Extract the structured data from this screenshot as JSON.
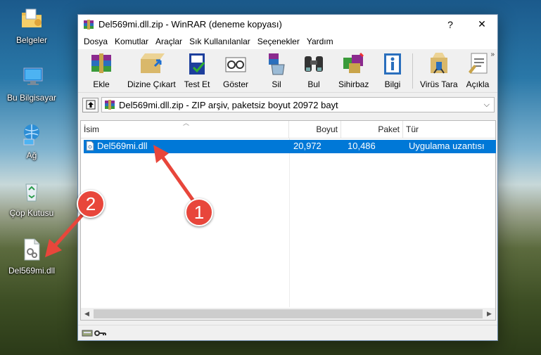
{
  "desktop": {
    "icons": [
      {
        "label": "Belgeler",
        "icon": "documents-folder-icon"
      },
      {
        "label": "Bu Bilgisayar",
        "icon": "computer-icon"
      },
      {
        "label": "Ağ",
        "icon": "network-icon"
      },
      {
        "label": "Çöp Kutusu",
        "icon": "recycle-bin-icon"
      },
      {
        "label": "Del569mi.dll",
        "icon": "dll-file-icon"
      }
    ]
  },
  "annotations": {
    "step1": "1",
    "step2": "2",
    "color": "#e8463b"
  },
  "window": {
    "title": "Del569mi.dll.zip - WinRAR (deneme kopyası)",
    "help": "?",
    "close": "✕"
  },
  "menu": [
    "Dosya",
    "Komutlar",
    "Araçlar",
    "Sık Kullanılanlar",
    "Seçenekler",
    "Yardım"
  ],
  "toolbar": [
    {
      "label": "Ekle",
      "icon": "add-archive-icon"
    },
    {
      "label": "Dizine Çıkart",
      "icon": "extract-to-icon"
    },
    {
      "label": "Test Et",
      "icon": "test-icon"
    },
    {
      "label": "Göster",
      "icon": "view-icon"
    },
    {
      "label": "Sil",
      "icon": "delete-icon"
    },
    {
      "label": "Bul",
      "icon": "find-icon"
    },
    {
      "label": "Sihirbaz",
      "icon": "wizard-icon"
    },
    {
      "label": "Bilgi",
      "icon": "info-icon"
    },
    {
      "label": "Virüs Tara",
      "icon": "virus-scan-icon"
    },
    {
      "label": "Açıkla",
      "icon": "comment-icon"
    }
  ],
  "toolbar_more": "»",
  "address": {
    "path": "Del569mi.dll.zip - ZIP arşiv, paketsiz boyut 20972 bayt",
    "dropdown": "⌵"
  },
  "columns": [
    "İsim",
    "Boyut",
    "Paket",
    "Tür"
  ],
  "files": [
    {
      "name": "Del569mi.dll",
      "size": "20,972",
      "packed": "10,486",
      "type": "Uygulama uzantısı",
      "selected": true
    }
  ],
  "accent": "#0078d7"
}
